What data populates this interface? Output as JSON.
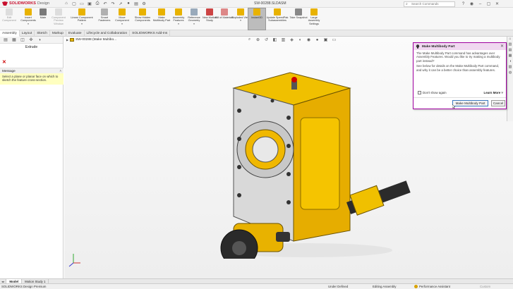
{
  "app": {
    "brand": "SOLIDWORKS",
    "product": "Design",
    "document_title": "SW-00288.SLDASM",
    "search_placeholder": "Search Commands"
  },
  "commands": [
    {
      "label": "Edit Component",
      "dropdown": "",
      "enabled": false
    },
    {
      "label": "Insert Components",
      "dropdown": "▾",
      "enabled": true
    },
    {
      "label": "Mate",
      "dropdown": "",
      "enabled": true
    },
    {
      "label": "Component Preview Window",
      "dropdown": "",
      "enabled": false
    },
    {
      "label": "Linear Component Pattern",
      "dropdown": "▾",
      "enabled": true
    },
    {
      "label": "Smart Fasteners",
      "dropdown": "",
      "enabled": true
    },
    {
      "label": "Move Component",
      "dropdown": "▾",
      "enabled": true
    },
    {
      "label": "Show Hidden Components",
      "dropdown": "",
      "enabled": true
    },
    {
      "label": "Make Multibody Part",
      "dropdown": "",
      "enabled": true
    },
    {
      "label": "Assembly Features",
      "dropdown": "▾",
      "enabled": true
    },
    {
      "label": "Reference Geometry",
      "dropdown": "▾",
      "enabled": true
    },
    {
      "label": "New Motion Study",
      "dropdown": "",
      "enabled": true
    },
    {
      "label": "Bill of Materials",
      "dropdown": "",
      "enabled": true
    },
    {
      "label": "Exploded View",
      "dropdown": "▾",
      "enabled": true
    },
    {
      "label": "Instant3D",
      "dropdown": "",
      "enabled": true,
      "active": true
    },
    {
      "label": "Update SpeedPak Subassemblies",
      "dropdown": "",
      "enabled": true
    },
    {
      "label": "Take Snapshot",
      "dropdown": "",
      "enabled": true
    },
    {
      "label": "Large Assembly Settings",
      "dropdown": "",
      "enabled": true
    }
  ],
  "tabs": [
    "Assembly",
    "Layout",
    "Sketch",
    "Markup",
    "Evaluate",
    "Lifecycle and Collaboration",
    "SOLIDWORKS Add-Ins"
  ],
  "left_panel": {
    "title": "Extrude",
    "message_header": "Message",
    "message_text": "Select a plane or planar face on which to sketch the feature cross-section."
  },
  "tree": {
    "root_label": "SW-00288 (Make Multibo..."
  },
  "popup": {
    "title": "Make Multibody Part",
    "paragraph1": "The Make Multibody Part command has advantages over Assembly Features. Would you like to try making a multibody part instead?",
    "paragraph2": "See below for details on the Make Multibody Part command, and why it can be a better choice than assembly features.",
    "dont_show": "Don't show again",
    "learn_more": "Learn More",
    "primary_button": "Make Multibody Part",
    "cancel_button": "Cancel"
  },
  "model_tabs": [
    "Model",
    "Motion Study 1"
  ],
  "status": {
    "product": "SOLIDWORKS Design Premium",
    "state": "Under Defined",
    "mode": "Editing Assembly",
    "assistant": "Performance Assistant",
    "units": "Custom"
  },
  "colors": {
    "brand_red": "#c8102e",
    "part_yellow": "#e8b200",
    "popup_border": "#a000a0",
    "message_bg": "#ffffc0"
  }
}
